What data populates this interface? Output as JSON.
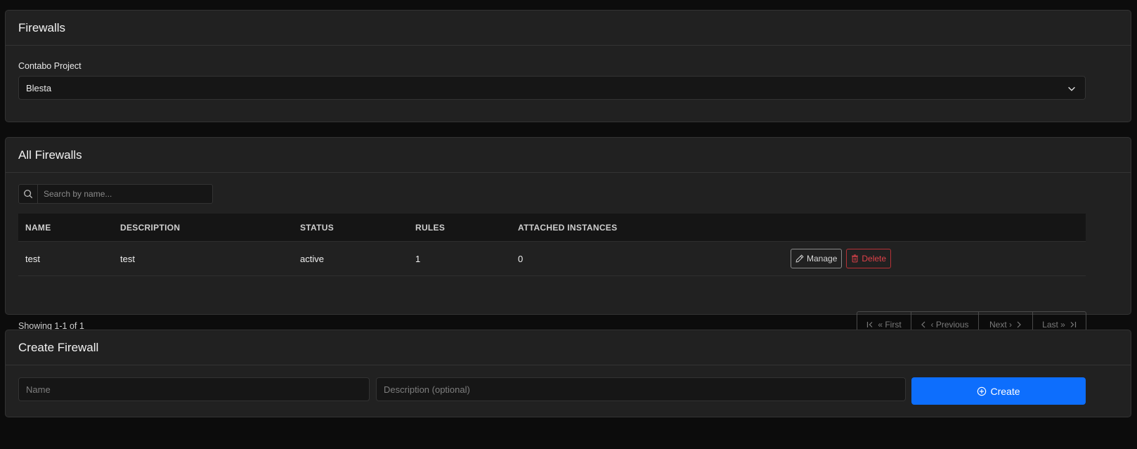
{
  "project_card": {
    "title": "Firewalls",
    "project_label": "Contabo Project",
    "project_selected": "Blesta"
  },
  "list_card": {
    "title": "All Firewalls",
    "search_placeholder": "Search by name...",
    "columns": [
      "NAME",
      "DESCRIPTION",
      "STATUS",
      "RULES",
      "ATTACHED INSTANCES"
    ],
    "rows": [
      {
        "name": "test",
        "description": "test",
        "status": "active",
        "rules": "1",
        "attached_instances": "0"
      }
    ],
    "manage_label": "Manage",
    "delete_label": "Delete",
    "showing": "Showing 1-1 of 1",
    "pagination": {
      "first": "« First",
      "previous": "‹ Previous",
      "next": "Next ›",
      "last": "Last »"
    }
  },
  "create_card": {
    "title": "Create Firewall",
    "name_placeholder": "Name",
    "description_placeholder": "Description (optional)",
    "create_label": "Create"
  },
  "colors": {
    "background": "#0c0c0c",
    "card": "#212121",
    "primary": "#0d6efd",
    "danger": "#e0424a"
  }
}
